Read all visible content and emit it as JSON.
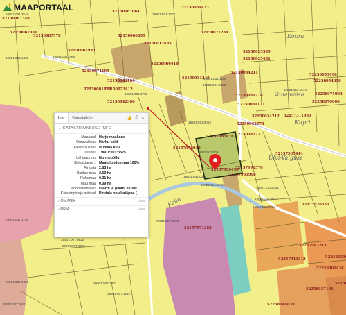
{
  "app": {
    "logo_text": "MAAPORTAAL"
  },
  "map": {
    "parcel_labels": [
      "52150067348",
      "52150067631",
      "52150087578",
      "52150087935",
      "52150074105",
      "52150081434",
      "52150087064",
      "52150066659",
      "52150015495",
      "52150061433",
      "52150043166",
      "52150042360",
      "52150023412",
      "52150025335",
      "52150025451",
      "52150034211",
      "52158086416",
      "52150077234",
      "52150031249",
      "52150031216",
      "52150031121",
      "52150062573",
      "52150045237",
      "52150034212",
      "52258054398",
      "52258053498",
      "52258075093",
      "52258070000",
      "52157311985",
      "52157965444",
      "52157965998",
      "52157995678",
      "52157996430",
      "52157970030",
      "52157996570",
      "52157926555",
      "52157974288",
      "52257983215",
      "52257913318",
      "52258033663",
      "52258061436",
      "52258037101",
      "52258051458",
      "52258048659"
    ],
    "cadastral_codes": [
      "19801:001:3548",
      "19801:001:1402",
      "19801:001:1407",
      "19801:001:0985",
      "19801:001:0783",
      "19801:001:3308",
      "19801:001:3302",
      "19801:011:1544",
      "19801:011:0004",
      "19801:011:0051",
      "19801:011:0001",
      "19801:001:0075",
      "19801:011:0017",
      "19801:011:0015",
      "19801:011:0003",
      "29901:007:1702",
      "29901:007:1601",
      "29901:007:0922",
      "29901:007:1601",
      "29901:007:0860",
      "29901:007:1023",
      "29901:007:0021",
      "29901:007:1622"
    ],
    "place_names": [
      "Kopra",
      "Vahemõisa",
      "Kupri",
      "Kella",
      "Ulvi-Valguse"
    ]
  },
  "popup": {
    "tabs": [
      "Info",
      "Katastaltöör"
    ],
    "section_title": "KATASTRIÜKSUSE INFO",
    "fields": [
      {
        "label": "Maakond",
        "value": "Harju maakond"
      },
      {
        "label": "Omavalitsus",
        "value": "Harku vald"
      },
      {
        "label": "Asustusüksus",
        "value": "Humala küla"
      },
      {
        "label": "Tunnus",
        "value": "19801:001:3325"
      },
      {
        "label": "Lähiaadress",
        "value": "Nurmepõllu"
      },
      {
        "label": "Sihtotstarve 1",
        "value": "Maatulundusmaa 100%"
      },
      {
        "label": "Pindala",
        "value": "2.83 ha"
      },
      {
        "label": "Haritav maa",
        "value": "2.53 ha"
      },
      {
        "label": "Rohumaa",
        "value": "0.21 ha"
      },
      {
        "label": "Muu maa",
        "value": "0.09 ha"
      },
      {
        "label": "Mõõdistamisviis",
        "value": "kaardi ja plaani alusel"
      },
      {
        "label": "Katastripidaja märked",
        "value": "Pindala on ebatäpne (..."
      }
    ],
    "omanik_label": "OMANIK",
    "omanik_right": "Ava",
    "pria_label": "PRIA",
    "pria_right": "Ava"
  }
}
